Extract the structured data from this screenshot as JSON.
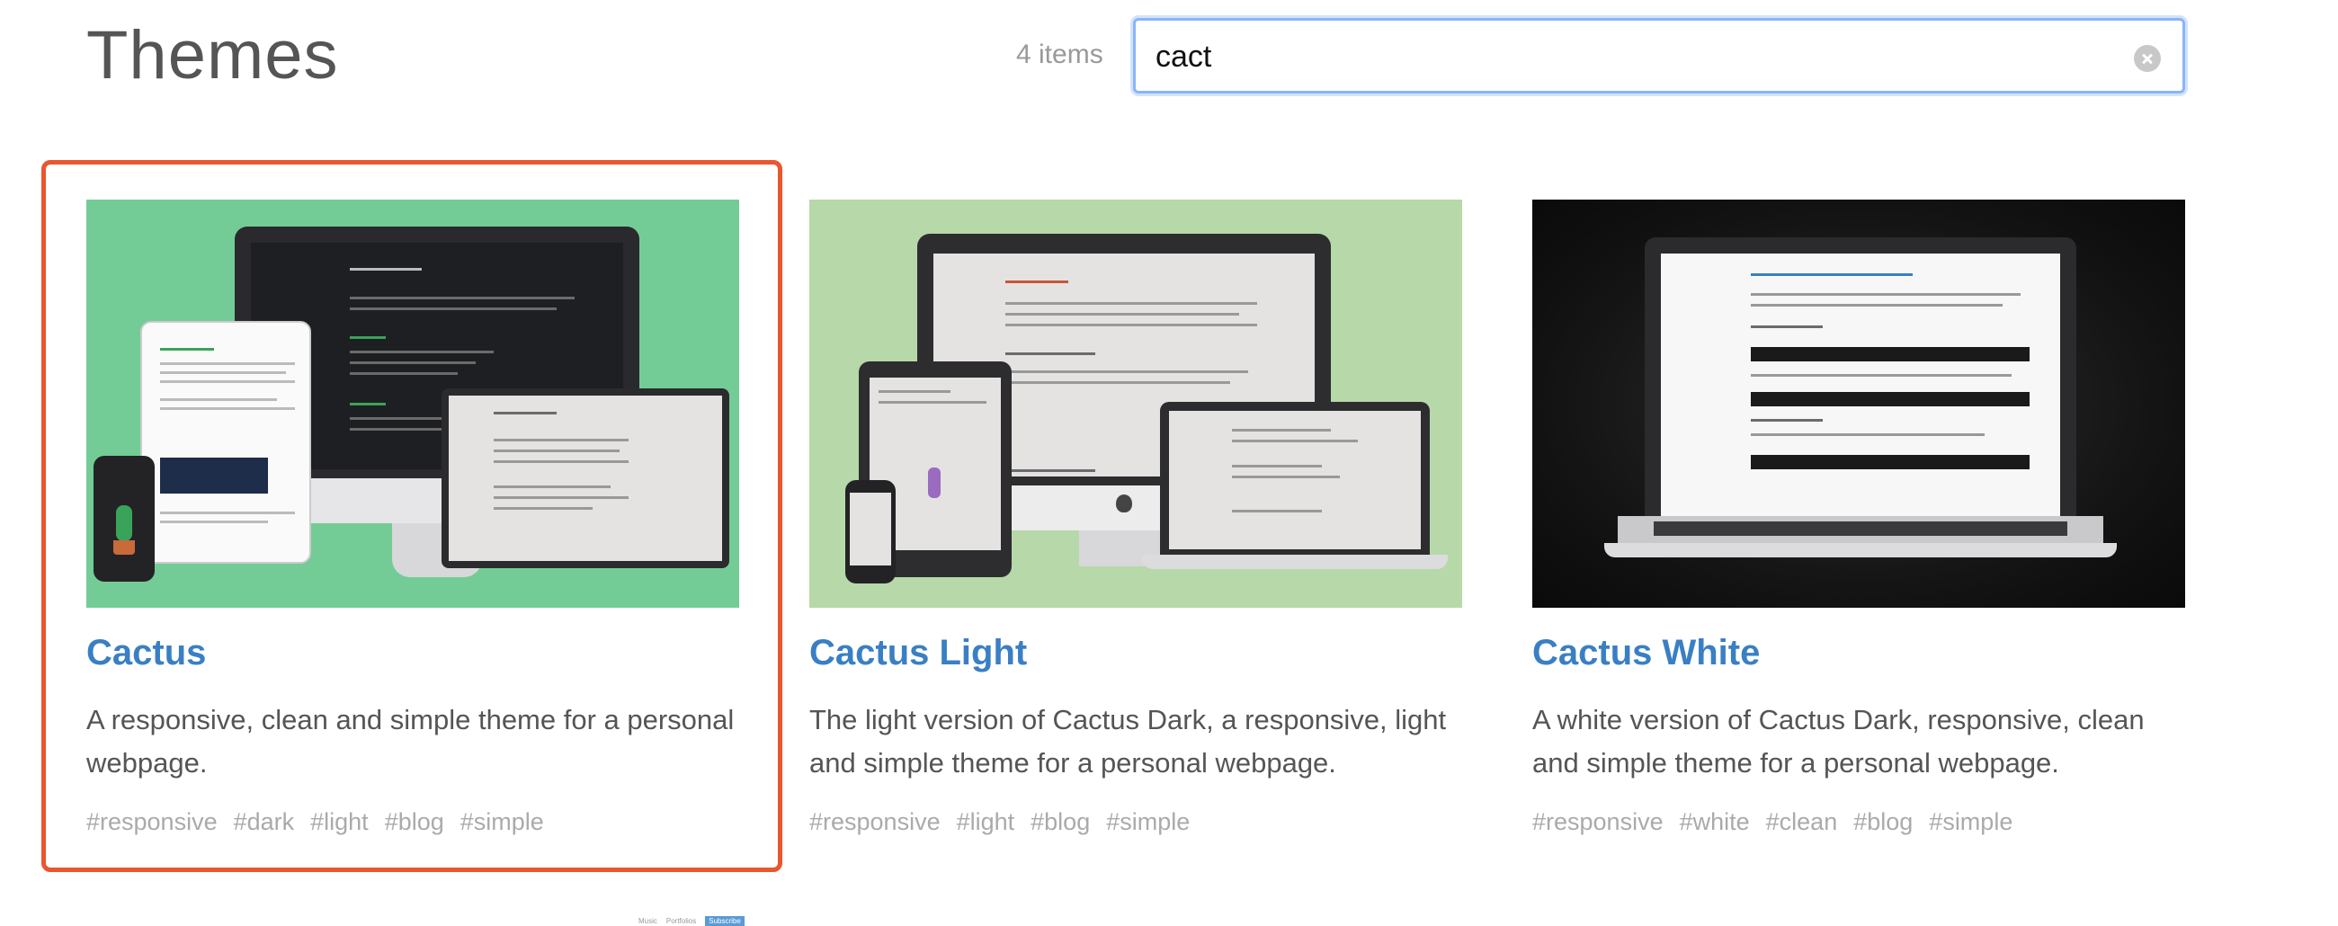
{
  "header": {
    "title": "Themes",
    "count": "4 items"
  },
  "search": {
    "value": "cact",
    "placeholder": ""
  },
  "themes": [
    {
      "name": "Cactus",
      "description": "A responsive, clean and simple theme for a personal webpage.",
      "tags": [
        "#responsive",
        "#dark",
        "#light",
        "#blog",
        "#simple"
      ],
      "selected": true
    },
    {
      "name": "Cactus Light",
      "description": "The light version of Cactus Dark, a responsive, light and simple theme for a personal webpage.",
      "tags": [
        "#responsive",
        "#light",
        "#blog",
        "#simple"
      ],
      "selected": false
    },
    {
      "name": "Cactus White",
      "description": "A white version of Cactus Dark, responsive, clean and simple theme for a personal webpage.",
      "tags": [
        "#responsive",
        "#white",
        "#clean",
        "#blog",
        "#simple"
      ],
      "selected": false
    }
  ],
  "footer": {
    "links": [
      "Music",
      "Portfolios",
      "Subscribe"
    ]
  },
  "colors": {
    "accent": "#3a7fc4",
    "selection": "#e8572f",
    "search_focus": "#8ab4f8"
  }
}
